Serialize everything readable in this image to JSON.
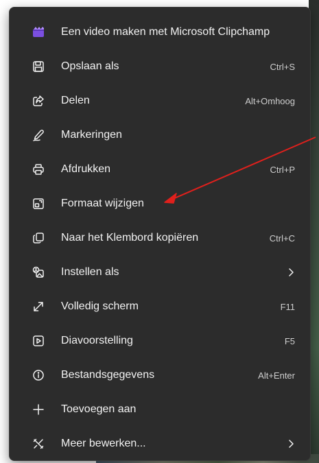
{
  "menu": {
    "items": [
      {
        "label": "Een video maken met Microsoft Clipchamp",
        "shortcut": "",
        "icon": "clipchamp-icon"
      },
      {
        "label": "Opslaan als",
        "shortcut": "Ctrl+S",
        "icon": "save-icon"
      },
      {
        "label": "Delen",
        "shortcut": "Alt+Omhoog",
        "icon": "share-icon"
      },
      {
        "label": "Markeringen",
        "shortcut": "",
        "icon": "markup-pen-icon"
      },
      {
        "label": "Afdrukken",
        "shortcut": "Ctrl+P",
        "icon": "printer-icon"
      },
      {
        "label": "Formaat wijzigen",
        "shortcut": "",
        "icon": "resize-icon"
      },
      {
        "label": "Naar het Klembord kopiëren",
        "shortcut": "Ctrl+C",
        "icon": "copy-icon"
      },
      {
        "label": "Instellen als",
        "shortcut": "",
        "icon": "set-as-icon",
        "submenu": true
      },
      {
        "label": "Volledig scherm",
        "shortcut": "F11",
        "icon": "fullscreen-icon"
      },
      {
        "label": "Diavoorstelling",
        "shortcut": "F5",
        "icon": "slideshow-icon"
      },
      {
        "label": "Bestandsgegevens",
        "shortcut": "Alt+Enter",
        "icon": "info-icon"
      },
      {
        "label": "Toevoegen aan",
        "shortcut": "",
        "icon": "plus-icon"
      },
      {
        "label": "Meer bewerken...",
        "shortcut": "",
        "icon": "edit-tools-icon",
        "submenu": true
      }
    ]
  },
  "colors": {
    "menu_background": "#2c2c2c",
    "text": "#f2f2f2",
    "shortcut_text": "#cfcfcf",
    "annotation_arrow": "#e0201c"
  }
}
